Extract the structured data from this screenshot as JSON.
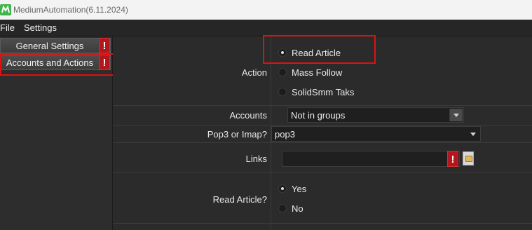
{
  "window": {
    "title": "MediumAutomation(6.11.2024)"
  },
  "menu": {
    "file": "File",
    "settings": "Settings"
  },
  "sidebar": {
    "items": [
      {
        "label": "General Settings",
        "warning": "!"
      },
      {
        "label": "Accounts and Actions",
        "warning": "!"
      }
    ]
  },
  "form": {
    "action": {
      "label": "Action",
      "options": [
        {
          "label": "Read Article",
          "checked": true
        },
        {
          "label": "Mass Follow",
          "checked": false
        },
        {
          "label": "SolidSmm Taks",
          "checked": false
        }
      ]
    },
    "accounts": {
      "label": "Accounts",
      "value": "Not in groups"
    },
    "pop3": {
      "label": "Pop3 or Imap?",
      "value": "pop3"
    },
    "links": {
      "label": "Links",
      "value": "",
      "warning": "!"
    },
    "read_article": {
      "label": "Read Article?",
      "options": [
        {
          "label": "Yes",
          "checked": true
        },
        {
          "label": "No",
          "checked": false
        }
      ]
    }
  },
  "colors": {
    "highlight": "#e01010",
    "warning": "#b3161c"
  },
  "icons": {
    "app": "app-logo-icon",
    "folder": "folder-icon"
  }
}
